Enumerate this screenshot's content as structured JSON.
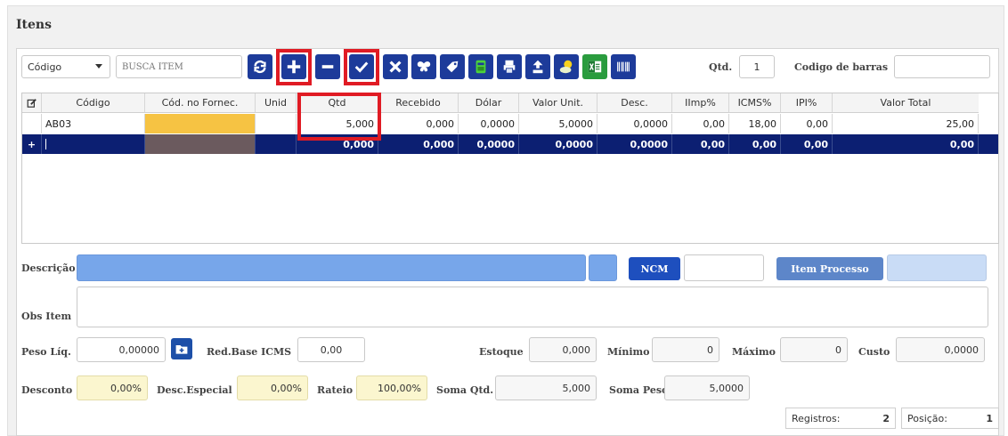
{
  "panel": {
    "title": "Itens"
  },
  "search": {
    "field_selected": "Código",
    "placeholder": "BUSCA ITEM",
    "qtd_label": "Qtd.",
    "qtd_value": "1",
    "barcode_label": "Codigo de barras",
    "barcode_value": ""
  },
  "toolbar": {
    "buttons": [
      {
        "name": "refresh-button",
        "icon": "refresh-icon"
      },
      {
        "name": "add-button",
        "icon": "plus-icon"
      },
      {
        "name": "remove-button",
        "icon": "minus-icon"
      },
      {
        "name": "confirm-button",
        "icon": "check-icon"
      },
      {
        "name": "cancel-button",
        "icon": "close-icon"
      },
      {
        "name": "butterfly-button",
        "icon": "butterfly-icon"
      },
      {
        "name": "tag-button",
        "icon": "tag-icon"
      },
      {
        "name": "green-tool-button",
        "icon": "calculator-icon"
      },
      {
        "name": "print-button",
        "icon": "printer-icon"
      },
      {
        "name": "upload-button",
        "icon": "upload-icon"
      },
      {
        "name": "weather-button",
        "icon": "cloud-sun-icon"
      },
      {
        "name": "excel-button",
        "icon": "excel-icon"
      },
      {
        "name": "barcode-button",
        "icon": "barcode-icon"
      }
    ]
  },
  "grid": {
    "columns": [
      "Código",
      "Cód. no Fornec.",
      "Unid",
      "Qtd",
      "Recebido",
      "Dólar",
      "Valor Unit.",
      "Desc.",
      "IImp%",
      "ICMS%",
      "IPI%",
      "Valor Total"
    ],
    "rows": [
      [
        "AB03",
        "",
        "",
        "5,000",
        "0,000",
        "0,0000",
        "5,0000",
        "0,0000",
        "0,00",
        "18,00",
        "0,00",
        "25,00"
      ]
    ],
    "new_row": {
      "marker": "+",
      "values": [
        "",
        "",
        "",
        "0,000",
        "0,000",
        "0,0000",
        "0,0000",
        "0,0000",
        "0,00",
        "0,00",
        "0,00",
        "0,00"
      ]
    }
  },
  "detail": {
    "descricao_label": "Descrição",
    "ncm_button": "NCM",
    "item_processo_button": "Item Processo",
    "obs_label": "Obs Item",
    "peso_liq_label": "Peso Líq.",
    "peso_liq_value": "0,00000",
    "red_base_icms_label": "Red.Base ICMS",
    "red_base_icms_value": "0,00",
    "estoque_label": "Estoque",
    "estoque_value": "0,000",
    "minimo_label": "Mínimo",
    "minimo_value": "0",
    "maximo_label": "Máximo",
    "maximo_value": "0",
    "custo_label": "Custo",
    "custo_value": "0,0000",
    "desconto_label": "Desconto",
    "desconto_value": "0,00%",
    "desc_especial_label": "Desc.Especial",
    "desc_especial_value": "0,00%",
    "rateio_label": "Rateio",
    "rateio_value": "100,00%",
    "soma_qtd_label": "Soma Qtd.",
    "soma_qtd_value": "5,000",
    "soma_peso_label": "Soma Peso",
    "soma_peso_value": "5,0000"
  },
  "status": {
    "registros_label": "Registros:",
    "registros_value": "2",
    "posicao_label": "Posição:",
    "posicao_value": "1"
  },
  "colors": {
    "toolbar_blue": "#1d3b9a",
    "selected_row": "#0c1f72",
    "highlight_red": "#e01b24",
    "fornec_yellow": "#f6c343"
  }
}
